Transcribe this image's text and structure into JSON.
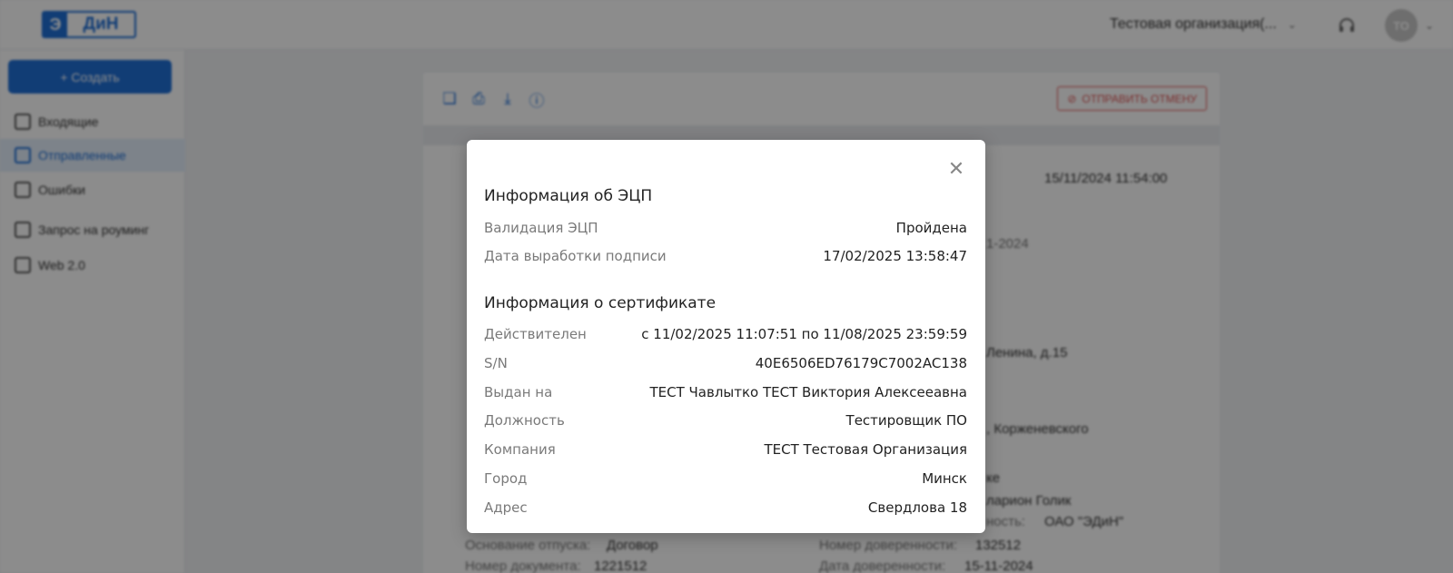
{
  "header": {
    "logo_mark": "Э",
    "logo_text": "ДиН",
    "organization": "Тестовая организация(...",
    "avatar_initials": "ТО"
  },
  "sidebar": {
    "create_label": "+ Создать",
    "items": [
      {
        "label": "Входящие"
      },
      {
        "label": "Отправленные"
      },
      {
        "label": "Ошибки"
      },
      {
        "label": "Запрос на роуминг"
      },
      {
        "label": "Web 2.0"
      }
    ]
  },
  "document": {
    "cancel_send_label": "ОТПРАВИТЬ ОТМЕНУ",
    "datetime": "15/11/2024 11:54:00",
    "date_fragment": "1-2024",
    "address_fragment": "Ленина, д.15",
    "address_fragment2": ", Корженевского",
    "fragment3": "ке",
    "fragment4": "ларион Голик",
    "fragment5_label": "ность:",
    "fragment5_value": "ОАО \"ЭДиН\"",
    "release_basis_label": "Основание отпуска:",
    "release_basis_value": "Договор",
    "doc_number_label": "Номер документа:",
    "doc_number_value": "1221512",
    "poa_number_label": "Номер доверенности:",
    "poa_number_value": "132512",
    "poa_date_label": "Дата доверенности:",
    "poa_date_value": "15-11-2024"
  },
  "modal": {
    "signature_title": "Информация об ЭЦП",
    "signature_rows": [
      {
        "label": "Валидация ЭЦП",
        "value": "Пройдена"
      },
      {
        "label": "Дата выработки подписи",
        "value": "17/02/2025 13:58:47"
      }
    ],
    "certificate_title": "Информация о сертификате",
    "certificate_rows": [
      {
        "label": "Действителен",
        "value": "с 11/02/2025 11:07:51 по 11/08/2025 23:59:59"
      },
      {
        "label": "S/N",
        "value": "40E6506ED76179C7002AC138"
      },
      {
        "label": "Выдан на",
        "value": "ТЕСТ Чавлытко ТЕСТ Виктория Алексееавна"
      },
      {
        "label": "Должность",
        "value": "Тестировщик ПО"
      },
      {
        "label": "Компания",
        "value": "ТЕСТ Тестовая Организация"
      },
      {
        "label": "Город",
        "value": "Минск"
      },
      {
        "label": "Адрес",
        "value": "Свердлова 18"
      }
    ]
  }
}
